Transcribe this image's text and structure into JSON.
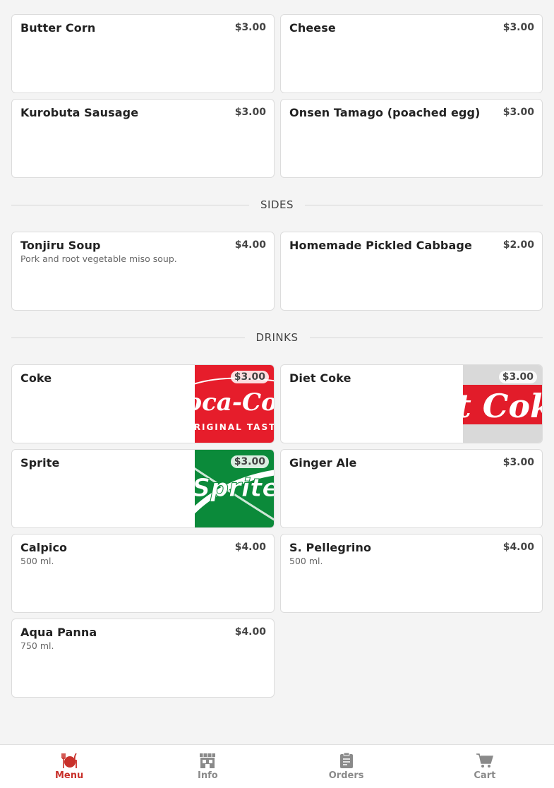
{
  "colors": {
    "accent": "#c8302a",
    "inactive": "#8a8a8a",
    "background": "#f4f4f4"
  },
  "toppings": [
    {
      "name": "Butter Corn",
      "price": "$3.00",
      "desc": ""
    },
    {
      "name": "Cheese",
      "price": "$3.00",
      "desc": ""
    },
    {
      "name": "Kurobuta Sausage",
      "price": "$3.00",
      "desc": ""
    },
    {
      "name": "Onsen Tamago (poached egg)",
      "price": "$3.00",
      "desc": ""
    }
  ],
  "sides": {
    "title": "SIDES",
    "items": [
      {
        "name": "Tonjiru Soup",
        "price": "$4.00",
        "desc": "Pork and root vegetable miso soup."
      },
      {
        "name": "Homemade Pickled Cabbage",
        "price": "$2.00",
        "desc": ""
      }
    ]
  },
  "drinks": {
    "title": "DRINKS",
    "items": [
      {
        "name": "Coke",
        "price": "$3.00",
        "desc": "",
        "image_text": "Coca-Cola",
        "image_subtext": "ORIGINAL TASTE"
      },
      {
        "name": "Diet Coke",
        "price": "$3.00",
        "desc": "",
        "image_text": "Diet Coke"
      },
      {
        "name": "Sprite",
        "price": "$3.00",
        "desc": "",
        "image_text": "Sprite"
      },
      {
        "name": "Ginger Ale",
        "price": "$3.00",
        "desc": ""
      },
      {
        "name": "Calpico",
        "price": "$4.00",
        "desc": "500 ml."
      },
      {
        "name": "S. Pellegrino",
        "price": "$4.00",
        "desc": "500 ml."
      },
      {
        "name": "Aqua Panna",
        "price": "$4.00",
        "desc": "750 ml."
      }
    ]
  },
  "nav": [
    {
      "label": "Menu",
      "icon": "fork-knife-plate-icon",
      "active": true
    },
    {
      "label": "Info",
      "icon": "store-icon",
      "active": false
    },
    {
      "label": "Orders",
      "icon": "clipboard-icon",
      "active": false
    },
    {
      "label": "Cart",
      "icon": "cart-icon",
      "active": false
    }
  ]
}
